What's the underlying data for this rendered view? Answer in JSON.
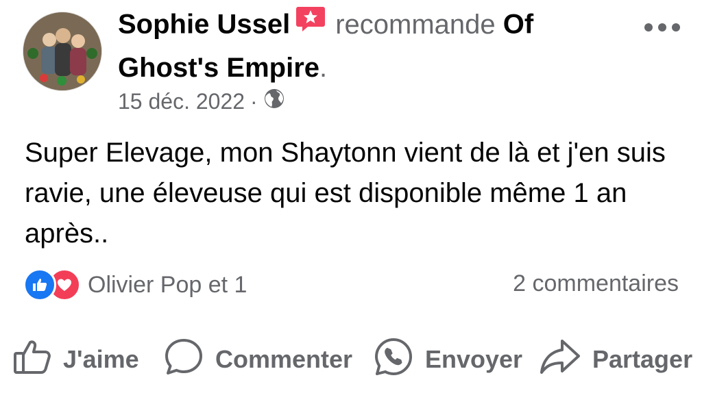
{
  "post": {
    "author": "Sophie Ussel",
    "verb": "recommande",
    "page_name": "Of Ghost's Empire",
    "period": ".",
    "date": "15 déc. 2022",
    "separator": "·",
    "visibility_icon": "globe-icon",
    "text": "Super Elevage,  mon Shaytonn vient de là et j'en suis ravie, une éleveuse qui est disponible même 1 an après..",
    "more_icon": "more-options-icon"
  },
  "reactions": {
    "icons": [
      "like-reaction-icon",
      "love-reaction-icon"
    ],
    "names": "Olivier Pop et 1",
    "comments": "2 commentaires"
  },
  "actions": [
    {
      "label": "J'aime",
      "icon": "thumbs-up-icon"
    },
    {
      "label": "Commenter",
      "icon": "comment-icon"
    },
    {
      "label": "Envoyer",
      "icon": "whatsapp-icon"
    },
    {
      "label": "Partager",
      "icon": "share-icon"
    }
  ],
  "colors": {
    "text": "#050505",
    "secondary": "#65676b",
    "like": "#1877f2",
    "love": "#f33e58",
    "badge": "#f3425f"
  }
}
